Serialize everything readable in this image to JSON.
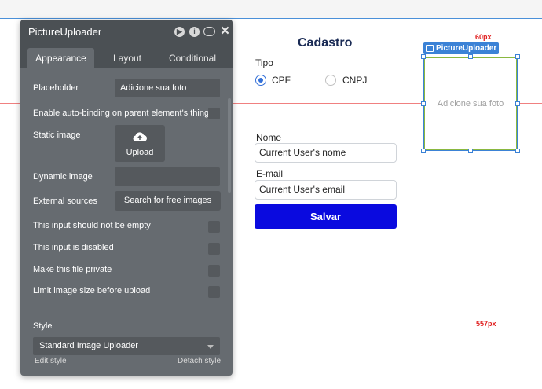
{
  "panel": {
    "title": "PictureUploader",
    "tabs": [
      "Appearance",
      "Layout",
      "Conditional"
    ],
    "placeholder_label": "Placeholder",
    "placeholder_value": "Adicione sua foto",
    "auto_binding_label": "Enable auto-binding on parent element's thing",
    "static_image_label": "Static image",
    "upload_label": "Upload",
    "dynamic_image_label": "Dynamic image",
    "external_sources_label": "External sources",
    "search_images_label": "Search for free images",
    "not_empty_label": "This input should not be empty",
    "disabled_label": "This input is disabled",
    "private_label": "Make this file private",
    "limit_size_label": "Limit image size before upload",
    "style_label": "Style",
    "style_value": "Standard Image Uploader",
    "edit_style": "Edit style",
    "detach_style": "Detach style"
  },
  "form": {
    "title": "Cadastro",
    "tipo_label": "Tipo",
    "option_cpf": "CPF",
    "option_cnpj": "CNPJ",
    "nome_label": "Nome",
    "nome_value": "Current User's nome",
    "email_label": "E-mail",
    "email_value": "Current User's email",
    "submit_label": "Salvar"
  },
  "uploader": {
    "tag": "PictureUploader",
    "placeholder": "Adicione sua foto"
  },
  "guides": {
    "top_distance": "60px",
    "right_distance": "557px"
  },
  "colors": {
    "primary_button": "#0a0adf",
    "selection": "#3b82d6",
    "guide": "#f08080"
  }
}
